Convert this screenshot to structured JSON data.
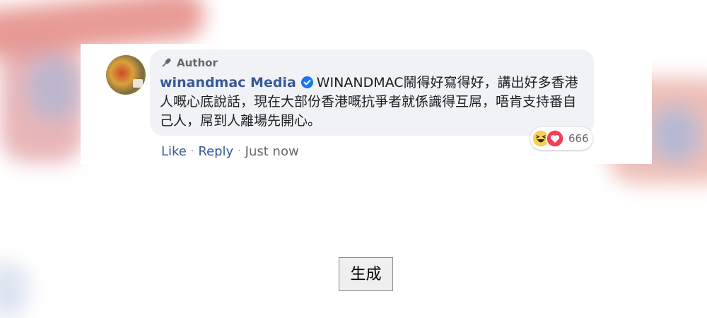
{
  "comment": {
    "author_badge": "Author",
    "author_name": "winandmac Media",
    "text": "WINANDMAC鬧得好寫得好，講出好多香港人嘅心底說話，現在大部份香港嘅抗爭者就係識得互屌，唔肯支持番自己人，屌到人離場先開心。",
    "reaction_count": "666",
    "reactions": [
      "haha-icon",
      "love-icon"
    ],
    "actions": {
      "like": "Like",
      "reply": "Reply",
      "time": "Just now"
    }
  },
  "generate_button": "生成",
  "colors": {
    "name": "#385898",
    "bubble": "#f0f2f5",
    "verified": "#1877f2"
  }
}
